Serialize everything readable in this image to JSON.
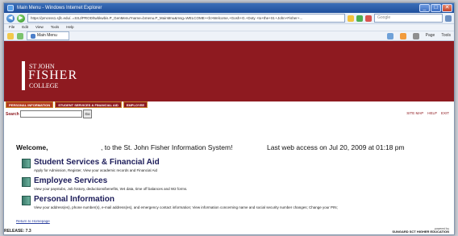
{
  "window": {
    "title": "Main Menu - Windows Internet Explorer"
  },
  "browser": {
    "address": "https://pmcsss1.sjfc.edu/..=SSJ/PROD/twbkwbis.P_GenMenu?name=bmenu.P_MainMnu&msg=WELCOME+<b>Welcome,+Gosh+G.+Doty +to+the+St.+John+Fisher+...",
    "search_placeholder": "Google",
    "menu_items": [
      "File",
      "Edit",
      "View",
      "Tools",
      "Help"
    ],
    "tab_label": "Main Menu",
    "commands": [
      "Page",
      "Tools"
    ]
  },
  "page": {
    "logo": {
      "line1": "ST JOHN",
      "line2": "FISHER",
      "line3": "COLLEGE"
    },
    "nav_tabs": [
      "PERSONAL INFORMATION",
      "STUDENT SERVICES & FINANCIAL AID",
      "EMPLOYEE"
    ],
    "search_label": "Search",
    "go_label": "Go",
    "right_links": [
      "SITE MAP",
      "HELP",
      "EXIT"
    ],
    "welcome_part1": "Welcome,",
    "welcome_part2": ", to the St. John Fisher Information System!",
    "welcome_part3": "Last web access on Jul 20, 2009 at 01:18 pm",
    "sections": [
      {
        "title": "Student Services & Financial Aid",
        "description": "Apply for Admission, Register, View your academic records and Financial Aid"
      },
      {
        "title": "Employee Services",
        "description": "View your paystubs, Job history, deductions/benefits, W4 data, time off balances and W2 forms."
      },
      {
        "title": "Personal Information",
        "description": "View your address(es), phone number(s), e-mail address(es), and emergency contact information; View information concerning name and social security number changes; Change your PIN;"
      }
    ],
    "return_link": "Return to Homepage",
    "release": "RELEASE: 7.3",
    "powered_by": "powered by",
    "powered_brand": "SUNGARD SCT HIGHER EDUCATION"
  }
}
